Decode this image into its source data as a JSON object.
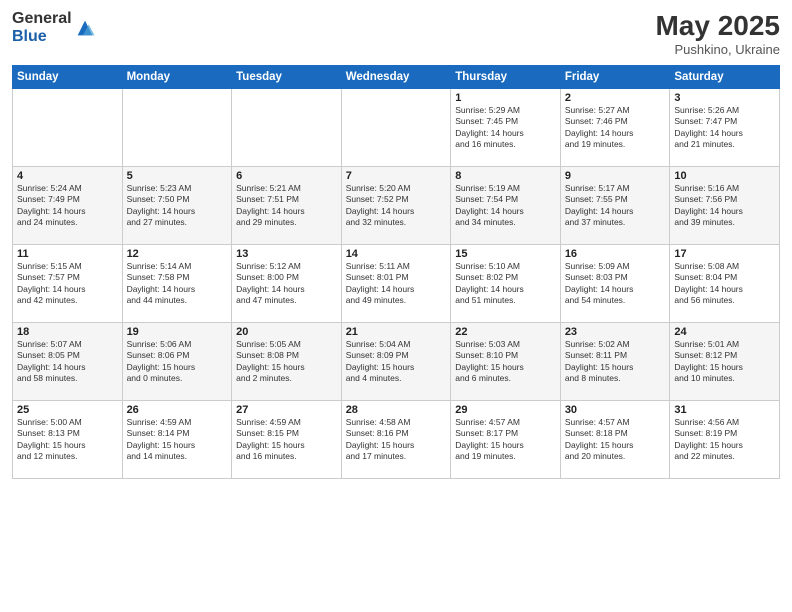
{
  "logo": {
    "general": "General",
    "blue": "Blue"
  },
  "title": "May 2025",
  "subtitle": "Pushkino, Ukraine",
  "days_of_week": [
    "Sunday",
    "Monday",
    "Tuesday",
    "Wednesday",
    "Thursday",
    "Friday",
    "Saturday"
  ],
  "weeks": [
    [
      {
        "day": "",
        "info": ""
      },
      {
        "day": "",
        "info": ""
      },
      {
        "day": "",
        "info": ""
      },
      {
        "day": "",
        "info": ""
      },
      {
        "day": "1",
        "info": "Sunrise: 5:29 AM\nSunset: 7:45 PM\nDaylight: 14 hours\nand 16 minutes."
      },
      {
        "day": "2",
        "info": "Sunrise: 5:27 AM\nSunset: 7:46 PM\nDaylight: 14 hours\nand 19 minutes."
      },
      {
        "day": "3",
        "info": "Sunrise: 5:26 AM\nSunset: 7:47 PM\nDaylight: 14 hours\nand 21 minutes."
      }
    ],
    [
      {
        "day": "4",
        "info": "Sunrise: 5:24 AM\nSunset: 7:49 PM\nDaylight: 14 hours\nand 24 minutes."
      },
      {
        "day": "5",
        "info": "Sunrise: 5:23 AM\nSunset: 7:50 PM\nDaylight: 14 hours\nand 27 minutes."
      },
      {
        "day": "6",
        "info": "Sunrise: 5:21 AM\nSunset: 7:51 PM\nDaylight: 14 hours\nand 29 minutes."
      },
      {
        "day": "7",
        "info": "Sunrise: 5:20 AM\nSunset: 7:52 PM\nDaylight: 14 hours\nand 32 minutes."
      },
      {
        "day": "8",
        "info": "Sunrise: 5:19 AM\nSunset: 7:54 PM\nDaylight: 14 hours\nand 34 minutes."
      },
      {
        "day": "9",
        "info": "Sunrise: 5:17 AM\nSunset: 7:55 PM\nDaylight: 14 hours\nand 37 minutes."
      },
      {
        "day": "10",
        "info": "Sunrise: 5:16 AM\nSunset: 7:56 PM\nDaylight: 14 hours\nand 39 minutes."
      }
    ],
    [
      {
        "day": "11",
        "info": "Sunrise: 5:15 AM\nSunset: 7:57 PM\nDaylight: 14 hours\nand 42 minutes."
      },
      {
        "day": "12",
        "info": "Sunrise: 5:14 AM\nSunset: 7:58 PM\nDaylight: 14 hours\nand 44 minutes."
      },
      {
        "day": "13",
        "info": "Sunrise: 5:12 AM\nSunset: 8:00 PM\nDaylight: 14 hours\nand 47 minutes."
      },
      {
        "day": "14",
        "info": "Sunrise: 5:11 AM\nSunset: 8:01 PM\nDaylight: 14 hours\nand 49 minutes."
      },
      {
        "day": "15",
        "info": "Sunrise: 5:10 AM\nSunset: 8:02 PM\nDaylight: 14 hours\nand 51 minutes."
      },
      {
        "day": "16",
        "info": "Sunrise: 5:09 AM\nSunset: 8:03 PM\nDaylight: 14 hours\nand 54 minutes."
      },
      {
        "day": "17",
        "info": "Sunrise: 5:08 AM\nSunset: 8:04 PM\nDaylight: 14 hours\nand 56 minutes."
      }
    ],
    [
      {
        "day": "18",
        "info": "Sunrise: 5:07 AM\nSunset: 8:05 PM\nDaylight: 14 hours\nand 58 minutes."
      },
      {
        "day": "19",
        "info": "Sunrise: 5:06 AM\nSunset: 8:06 PM\nDaylight: 15 hours\nand 0 minutes."
      },
      {
        "day": "20",
        "info": "Sunrise: 5:05 AM\nSunset: 8:08 PM\nDaylight: 15 hours\nand 2 minutes."
      },
      {
        "day": "21",
        "info": "Sunrise: 5:04 AM\nSunset: 8:09 PM\nDaylight: 15 hours\nand 4 minutes."
      },
      {
        "day": "22",
        "info": "Sunrise: 5:03 AM\nSunset: 8:10 PM\nDaylight: 15 hours\nand 6 minutes."
      },
      {
        "day": "23",
        "info": "Sunrise: 5:02 AM\nSunset: 8:11 PM\nDaylight: 15 hours\nand 8 minutes."
      },
      {
        "day": "24",
        "info": "Sunrise: 5:01 AM\nSunset: 8:12 PM\nDaylight: 15 hours\nand 10 minutes."
      }
    ],
    [
      {
        "day": "25",
        "info": "Sunrise: 5:00 AM\nSunset: 8:13 PM\nDaylight: 15 hours\nand 12 minutes."
      },
      {
        "day": "26",
        "info": "Sunrise: 4:59 AM\nSunset: 8:14 PM\nDaylight: 15 hours\nand 14 minutes."
      },
      {
        "day": "27",
        "info": "Sunrise: 4:59 AM\nSunset: 8:15 PM\nDaylight: 15 hours\nand 16 minutes."
      },
      {
        "day": "28",
        "info": "Sunrise: 4:58 AM\nSunset: 8:16 PM\nDaylight: 15 hours\nand 17 minutes."
      },
      {
        "day": "29",
        "info": "Sunrise: 4:57 AM\nSunset: 8:17 PM\nDaylight: 15 hours\nand 19 minutes."
      },
      {
        "day": "30",
        "info": "Sunrise: 4:57 AM\nSunset: 8:18 PM\nDaylight: 15 hours\nand 20 minutes."
      },
      {
        "day": "31",
        "info": "Sunrise: 4:56 AM\nSunset: 8:19 PM\nDaylight: 15 hours\nand 22 minutes."
      }
    ]
  ]
}
